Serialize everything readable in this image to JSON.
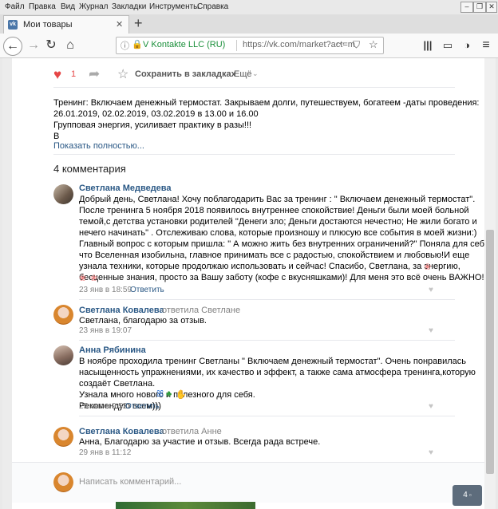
{
  "browser": {
    "menu": [
      "Файл",
      "Правка",
      "Вид",
      "Журнал",
      "Закладки",
      "Инструменты",
      "Справка"
    ],
    "tab_title": "Мои товары",
    "new_tab": "+",
    "site_identity": "V Kontakte LLC (RU)",
    "url": "https://vk.com/market?act=m",
    "url_more": "···"
  },
  "post_actions": {
    "likes": "1",
    "bookmark_label": "Сохранить в закладках",
    "more_label": "Ещё"
  },
  "description": {
    "lines": [
      "Тренинг: Включаем денежный термостат. Закрываем долги, путешествуем, богатеем -даты проведения:",
      "26.01.2019, 02.02.2019, 03.02.2019 в 13.00 и 16.00",
      "Групповая энергия, усиливает практику в разы!!!",
      "В"
    ],
    "show_more": "Показать полностью..."
  },
  "comments_header": "4 комментария",
  "comments": [
    {
      "author": "Светлана Медведева",
      "reply_to": "",
      "lines": [
        "Добрый день, Светлана! Хочу поблагодарить Вас за тренинг : \" Включаем денежный термостат\".",
        "После тренинга 5 ноября 2018 появилось внутреннее спокойствие! Деньги были моей больной",
        "темой,с детства установки родителей \"Денеги зло; Деньги достаются нечестно; Не жили богато и",
        "нечего начинать\" . Отслеживаю слова, которые произношу и плюсую все события в моей жизни:)",
        "Главный вопрос с которым пришла: \" А можно жить без внутренних ограничений?\" Поняла для себя,",
        "что Вселенная изобильна, главное принимать все с радостью, спокойствием и любовью!И еще",
        "узнала техники, которые продолжаю использовать и сейчас! Спасибо, Светлана, за энергию,",
        "бесценные знания, просто за Вашу заботу (кофе с вкусняшками)! Для меня это всё очень ВАЖНО!"
      ],
      "date": "23 янв в 18:59",
      "reply_label": "Ответить"
    },
    {
      "author": "Светлана Ковалева",
      "reply_to": "ответила Светлане",
      "lines": [
        "Светлана, благодарю за отзыв."
      ],
      "date": "23 янв в 19:07",
      "reply_label": ""
    },
    {
      "author": "Анна Рябинина",
      "reply_to": "",
      "lines": [
        "В ноябре проходила тренинг Светланы \" Включаем денежный термостат\". Очень понравилась",
        "насыщенность упражнениями, их качество и эффект, а также сама атмосфера тренинга,которую",
        "создаёт Светлана.",
        "Узнала много нового и полезного для себя.",
        "Рекомендую всем)))"
      ],
      "date": "25 янв в 9:52",
      "reply_label": "Ответить"
    },
    {
      "author": "Светлана Ковалева",
      "reply_to": "ответила Анне",
      "lines": [
        "Анна, Благодарю за участие и отзыв. Всегда рада встрече."
      ],
      "date": "29 янв в 11:12",
      "reply_label": ""
    }
  ],
  "comment_input": {
    "placeholder": "Написать комментарий..."
  },
  "badge_count": "4",
  "colors": {
    "link": "#2a5885",
    "like": "#e64646",
    "meta": "#828282"
  }
}
